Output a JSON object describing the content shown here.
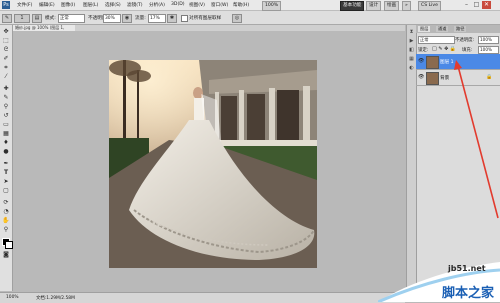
{
  "menubar": {
    "app_icon": "Ps",
    "items": [
      "文件(F)",
      "编辑(E)",
      "图像(I)",
      "图层(L)",
      "选择(S)",
      "滤镜(T)",
      "分析(A)",
      "3D(D)",
      "视图(V)",
      "窗口(W)",
      "帮助(H)"
    ],
    "zoom": "100%",
    "workspace_label": "基本功能",
    "design_label": "设计",
    "painting_label": "绘画",
    "more_label": "»",
    "cslive_label": "CS Live",
    "min": "–",
    "restore": "□",
    "close": "✕"
  },
  "options": {
    "brush_size": "1",
    "mode_label": "模式:",
    "mode_value": "正常",
    "opacity_label": "不透明度:",
    "opacity_value": "30%",
    "flow_label": "流量:",
    "flow_value": "17%",
    "sample_label": "对所有图层取样"
  },
  "document": {
    "tab_label": "婚纱.jpg @ 100% (图层 1, RGB/8) ×"
  },
  "status": {
    "zoom": "100%",
    "doc_info": "文档:1.29M/2.58M"
  },
  "layers_panel": {
    "tabs": [
      "图层",
      "通道",
      "路径"
    ],
    "blend_mode": "正常",
    "opacity_label": "不透明度:",
    "opacity_value": "100%",
    "lock_label": "锁定:",
    "fill_label": "填充:",
    "fill_value": "100%",
    "layers": [
      {
        "name": "图层 1",
        "selected": true
      },
      {
        "name": "背景",
        "selected": false
      }
    ]
  },
  "icons": {
    "tools": [
      "move-icon",
      "marquee-icon",
      "lasso-icon",
      "quick-select-icon",
      "crop-icon",
      "eyedropper-icon",
      "healing-brush-icon",
      "brush-icon",
      "clone-stamp-icon",
      "history-brush-icon",
      "eraser-icon",
      "gradient-icon",
      "blur-icon",
      "dodge-icon",
      "pen-icon",
      "type-icon",
      "path-select-icon",
      "shape-icon",
      "3d-rotate-icon",
      "3d-orbit-icon",
      "hand-icon",
      "zoom-icon"
    ]
  },
  "watermark": {
    "site": "jb51.net",
    "brand": "脚本之家"
  },
  "colors": {
    "selected_layer": "#4b89e6",
    "annotation_arrow": "#e23b2e",
    "canvas_bg": "#b9b9b9"
  }
}
